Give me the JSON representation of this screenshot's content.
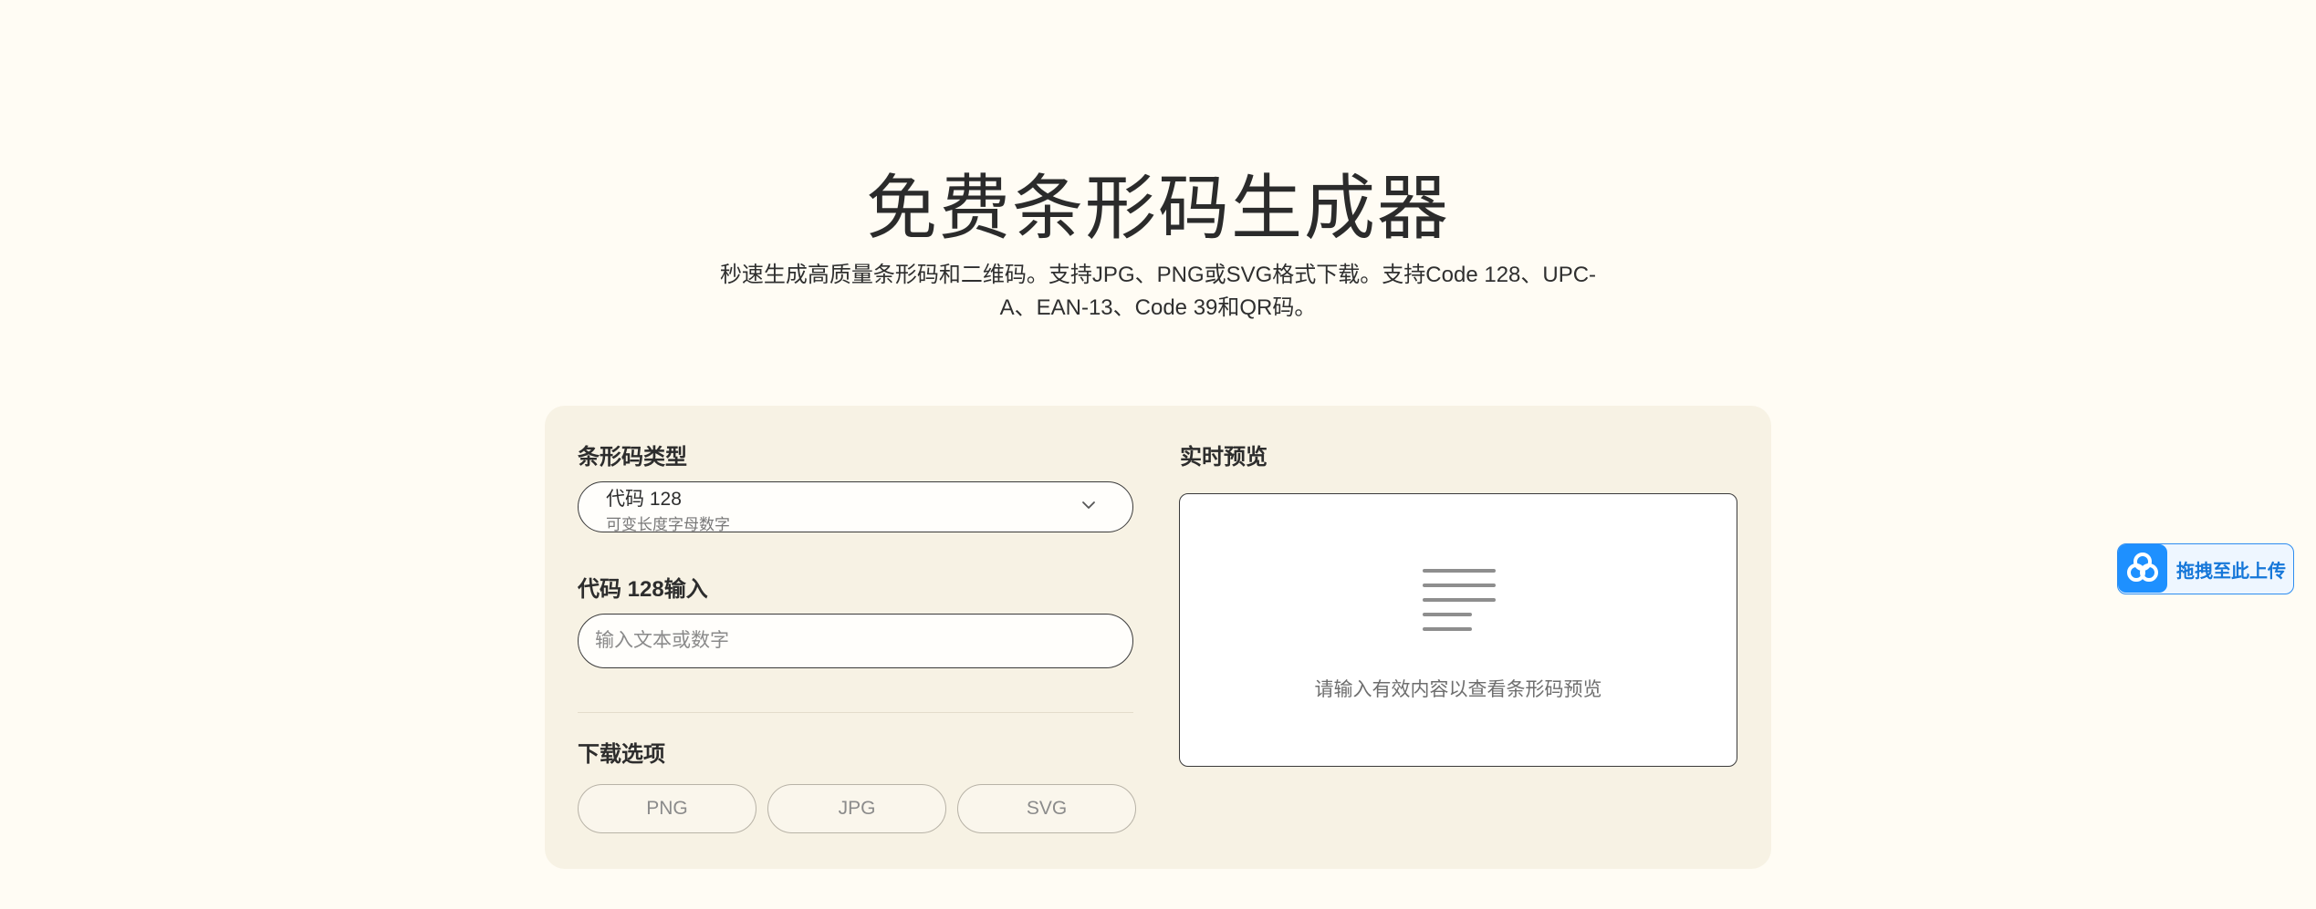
{
  "header": {
    "title": "免费条形码生成器",
    "subtitle": "秒速生成高质量条形码和二维码。支持JPG、PNG或SVG格式下载。支持Code 128、UPC-A、EAN-13、Code 39和QR码。"
  },
  "form": {
    "barcode_type_label": "条形码类型",
    "selected_type": "代码 128",
    "selected_type_desc": "可变长度字母数字",
    "input_label": "代码 128输入",
    "input_placeholder": "输入文本或数字",
    "input_value": "",
    "download_label": "下载选项",
    "download_buttons": [
      "PNG",
      "JPG",
      "SVG"
    ]
  },
  "preview": {
    "label": "实时预览",
    "empty_message": "请输入有效内容以查看条形码预览",
    "icon": "text-lines-icon"
  },
  "upload_widget": {
    "label": "拖拽至此上传",
    "icon": "cloud-logo-icon"
  },
  "colors": {
    "background": "#fffcf4",
    "card": "#f7f2e4",
    "accent_blue": "#1e90ff"
  }
}
